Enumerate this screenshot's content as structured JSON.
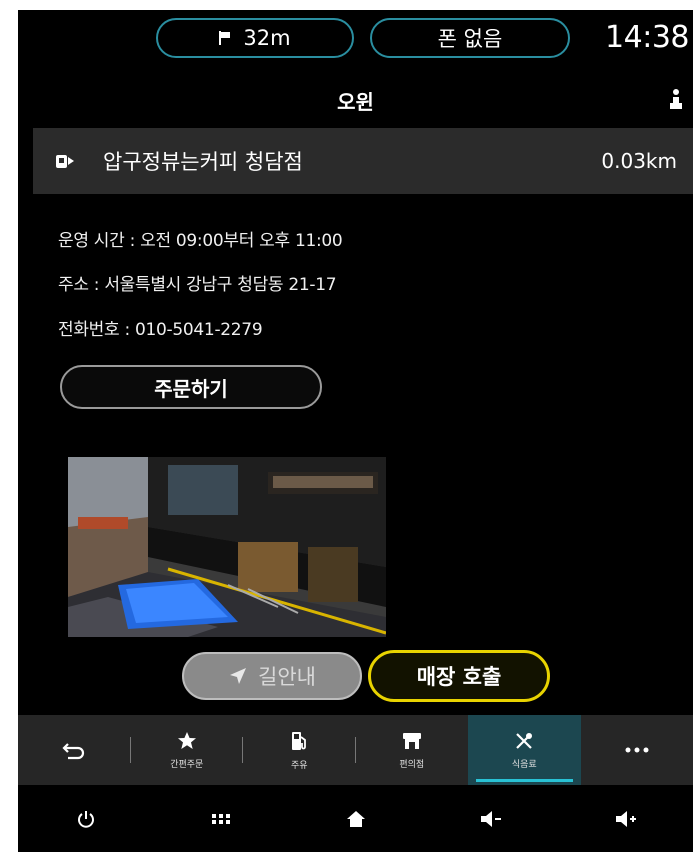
{
  "status_bar": {
    "distance": "32m",
    "phone": "폰 없음",
    "time": "14:38",
    "accent": "#2a8ea0"
  },
  "header": {
    "title": "오윈"
  },
  "place": {
    "name": "압구정뷰는커피 청담점",
    "distance": "0.03km"
  },
  "info": {
    "hours": "운영 시간 : 오전 09:00부터 오후 11:00",
    "address": "주소 : 서울특별시 강남구 청담동 21-17",
    "phone": "전화번호 : 010-5041-2279"
  },
  "buttons": {
    "order": "주문하기",
    "navigate": "길안내",
    "call_store": "매장 호출",
    "call_store_border": "#e8d300"
  },
  "tabbar": {
    "items": [
      {
        "label": "",
        "icon": "back-icon"
      },
      {
        "label": "간편주문",
        "icon": "star-icon"
      },
      {
        "label": "주유",
        "icon": "fuel-icon"
      },
      {
        "label": "편의점",
        "icon": "store-icon"
      },
      {
        "label": "식음료",
        "icon": "utensils-icon",
        "active": true
      },
      {
        "label": "",
        "icon": "more-icon"
      }
    ],
    "active_color": "#29c3d6"
  },
  "bottom_bar": {
    "icons": [
      "power-icon",
      "apps-grid-icon",
      "home-icon",
      "volume-down-icon",
      "volume-up-icon"
    ]
  }
}
